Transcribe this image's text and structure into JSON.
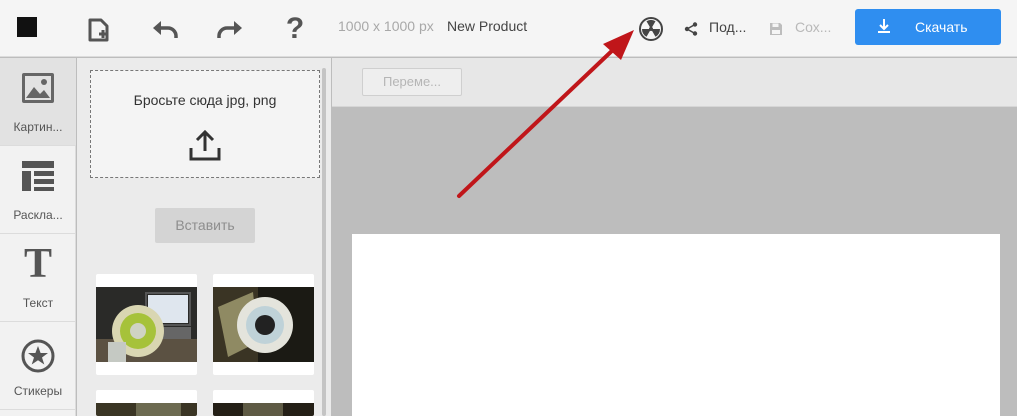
{
  "toolbar": {
    "size_text": "1000 x 1000 px",
    "product_name": "New Product",
    "share_label": "Под...",
    "save_label": "Сох...",
    "download_label": "Скачать",
    "accent_color": "#2f8ef0"
  },
  "tools": [
    {
      "label": "Картин...",
      "icon": "image-icon",
      "active": true
    },
    {
      "label": "Раскла...",
      "icon": "layout-icon",
      "active": false
    },
    {
      "label": "Текст",
      "icon": "text-icon",
      "active": false
    },
    {
      "label": "Стикеры",
      "icon": "sticker-icon",
      "active": false
    }
  ],
  "panel": {
    "dropzone_text": "Бросьте сюда jpg, png",
    "insert_label": "Вставить"
  },
  "canvas": {
    "move_label": "Переме..."
  },
  "annotation": {
    "arrow_color": "#c0161a",
    "points_to": "radioactive-icon"
  }
}
